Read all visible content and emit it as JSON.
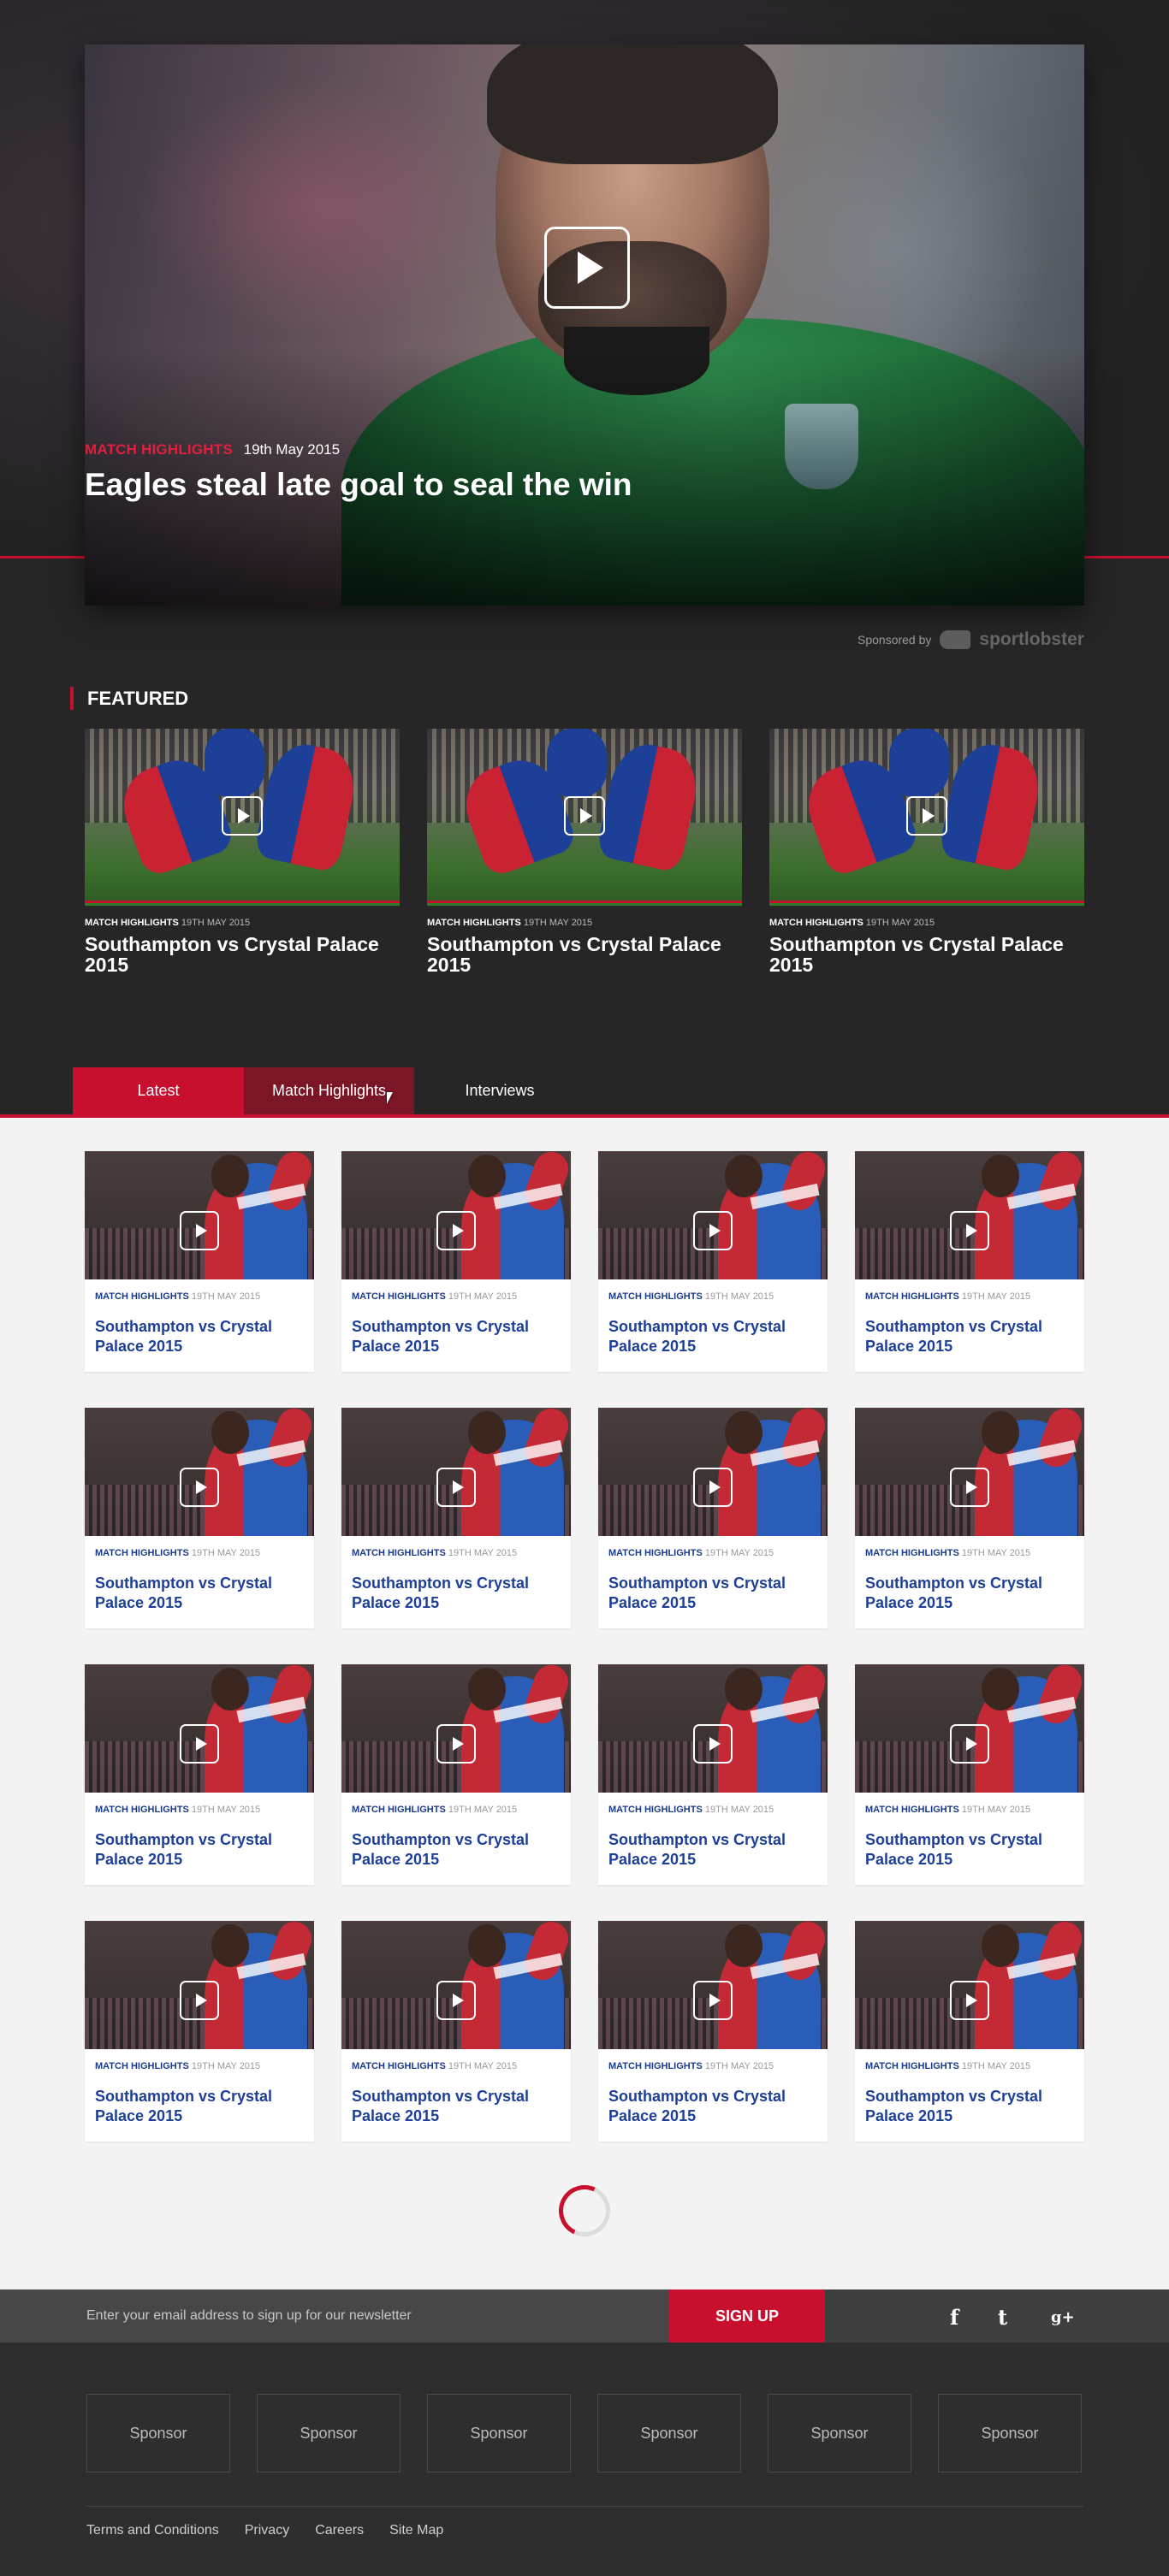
{
  "hero": {
    "category": "MATCH HIGHLIGHTS",
    "date": "19th May 2015",
    "title": "Eagles steal late goal to seal the win",
    "sponsored_label": "Sponsored by",
    "sponsor_name": "sportlobster"
  },
  "featured": {
    "heading": "FEATURED",
    "cards": [
      {
        "category": "MATCH HIGHLIGHTS",
        "date": "19TH MAY 2015",
        "title": "Southampton vs Crystal Palace 2015"
      },
      {
        "category": "MATCH HIGHLIGHTS",
        "date": "19TH MAY 2015",
        "title": "Southampton vs Crystal Palace 2015"
      },
      {
        "category": "MATCH HIGHLIGHTS",
        "date": "19TH MAY 2015",
        "title": "Southampton vs Crystal Palace 2015"
      }
    ]
  },
  "tabs": [
    {
      "label": "Latest"
    },
    {
      "label": "Match Highlights"
    },
    {
      "label": "Interviews"
    }
  ],
  "grid": [
    {
      "category": "MATCH HIGHLIGHTS",
      "date": "19TH MAY 2015",
      "title": "Southampton vs Crystal Palace 2015"
    },
    {
      "category": "MATCH HIGHLIGHTS",
      "date": "19TH MAY 2015",
      "title": "Southampton vs Crystal Palace 2015"
    },
    {
      "category": "MATCH HIGHLIGHTS",
      "date": "19TH MAY 2015",
      "title": "Southampton vs Crystal Palace 2015"
    },
    {
      "category": "MATCH HIGHLIGHTS",
      "date": "19TH MAY 2015",
      "title": "Southampton vs Crystal Palace 2015"
    },
    {
      "category": "MATCH HIGHLIGHTS",
      "date": "19TH MAY 2015",
      "title": "Southampton vs Crystal Palace 2015"
    },
    {
      "category": "MATCH HIGHLIGHTS",
      "date": "19TH MAY 2015",
      "title": "Southampton vs Crystal Palace 2015"
    },
    {
      "category": "MATCH HIGHLIGHTS",
      "date": "19TH MAY 2015",
      "title": "Southampton vs Crystal Palace 2015"
    },
    {
      "category": "MATCH HIGHLIGHTS",
      "date": "19TH MAY 2015",
      "title": "Southampton vs Crystal Palace 2015"
    },
    {
      "category": "MATCH HIGHLIGHTS",
      "date": "19TH MAY 2015",
      "title": "Southampton vs Crystal Palace 2015"
    },
    {
      "category": "MATCH HIGHLIGHTS",
      "date": "19TH MAY 2015",
      "title": "Southampton vs Crystal Palace 2015"
    },
    {
      "category": "MATCH HIGHLIGHTS",
      "date": "19TH MAY 2015",
      "title": "Southampton vs Crystal Palace 2015"
    },
    {
      "category": "MATCH HIGHLIGHTS",
      "date": "19TH MAY 2015",
      "title": "Southampton vs Crystal Palace 2015"
    },
    {
      "category": "MATCH HIGHLIGHTS",
      "date": "19TH MAY 2015",
      "title": "Southampton vs Crystal Palace 2015"
    },
    {
      "category": "MATCH HIGHLIGHTS",
      "date": "19TH MAY 2015",
      "title": "Southampton vs Crystal Palace 2015"
    },
    {
      "category": "MATCH HIGHLIGHTS",
      "date": "19TH MAY 2015",
      "title": "Southampton vs Crystal Palace 2015"
    },
    {
      "category": "MATCH HIGHLIGHTS",
      "date": "19TH MAY 2015",
      "title": "Southampton vs Crystal Palace 2015"
    }
  ],
  "newsletter": {
    "placeholder": "Enter your email address to sign up for our newsletter",
    "button": "SIGN UP"
  },
  "social": {
    "facebook": "f",
    "twitter": "t",
    "googleplus": "g+"
  },
  "sponsors": [
    "Sponsor",
    "Sponsor",
    "Sponsor",
    "Sponsor",
    "Sponsor",
    "Sponsor"
  ],
  "footer_links": [
    "Terms and Conditions",
    "Privacy",
    "Careers",
    "Site Map"
  ],
  "colors": {
    "accent": "#c8102e",
    "accent_dark": "#7b1626",
    "link_blue": "#1d3f98",
    "background_dark": "#262626",
    "grid_background": "#f3f3f3"
  },
  "icons": [
    "play-icon",
    "sportlobster-logo-icon",
    "facebook-icon",
    "twitter-icon",
    "google-plus-icon",
    "loading-spinner-icon",
    "cursor-icon"
  ]
}
